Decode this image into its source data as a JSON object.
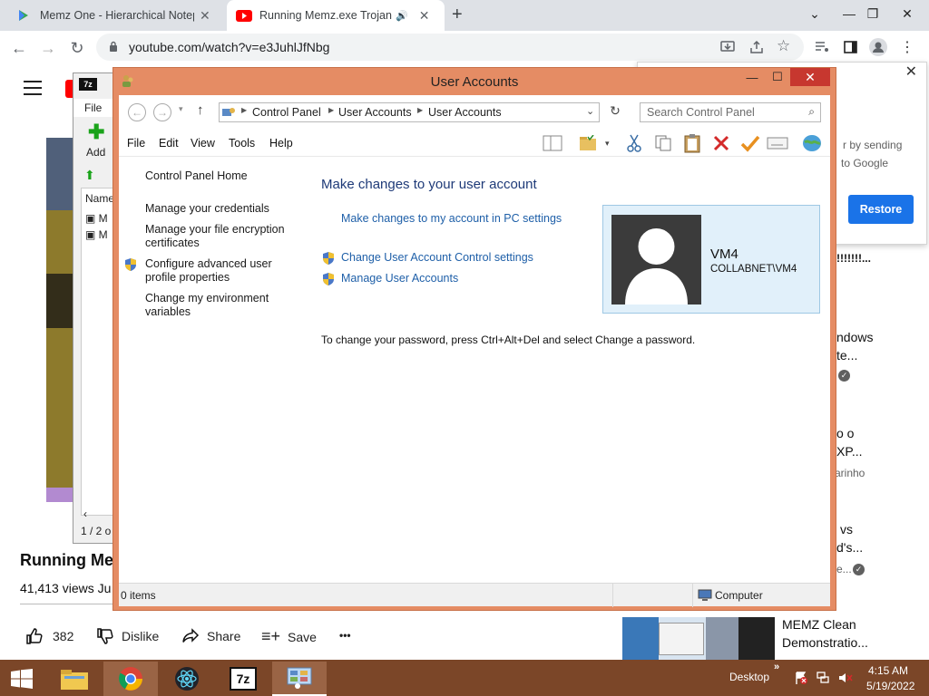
{
  "browser": {
    "tabs": [
      {
        "title": "Memz One - Hierarchical Notepad"
      },
      {
        "title": "Running Memz.exe Trojan on"
      }
    ],
    "url": "youtube.com/watch?v=e3JuhlJfNbg"
  },
  "youtube": {
    "video_title": "Running Mem",
    "views": "41,413 views  Ju",
    "likes": "382",
    "dislike_label": "Dislike",
    "share_label": "Share",
    "save_label": "Save",
    "more_label": "•••",
    "restore_label": "Restore",
    "dialog_text": [
      "r by sending",
      "to Google"
    ],
    "sidebar_fragments": [
      "!!!!!!!...",
      "ndows",
      "te...",
      "o o",
      "XP...",
      "arinho",
      "vs",
      "d's...",
      "e...",
      "MEMZ Clean",
      "Demonstratio..."
    ]
  },
  "sevenzip": {
    "menu_file": "File",
    "add_label": "Add",
    "name_col": "Name",
    "rows": [
      "M",
      "M"
    ],
    "status": "1 / 2 o"
  },
  "window": {
    "title": "User Accounts",
    "breadcrumb": [
      "Control Panel",
      "User Accounts",
      "User Accounts"
    ],
    "search_placeholder": "Search Control Panel",
    "menu": [
      "File",
      "Edit",
      "View",
      "Tools",
      "Help"
    ],
    "sidebar": {
      "home": "Control Panel Home",
      "credentials": "Manage your credentials",
      "encryption_1": "Manage your file encryption",
      "encryption_2": "certificates",
      "advanced_1": "Configure advanced user",
      "advanced_2": "profile properties",
      "environment_1": "Change my environment",
      "environment_2": "variables"
    },
    "main": {
      "heading": "Make changes to your user account",
      "pc_settings": "Make changes to my account in PC settings",
      "uac": "Change User Account Control settings",
      "manage": "Manage User Accounts",
      "password_note": "To change your password, press Ctrl+Alt+Del and select Change a password."
    },
    "user": {
      "name": "VM4",
      "domain": "COLLABNET\\VM4"
    },
    "status": {
      "items": "0 items",
      "location": "Computer"
    }
  },
  "taskbar": {
    "desktop_label": "Desktop",
    "time": "4:15 AM",
    "date": "5/19/2022",
    "sevenzip_label": "7z"
  },
  "colors": {
    "window_frame": "#e58c64",
    "close_red": "#c7372f",
    "link_blue": "#1e5fa8",
    "taskbar": "#7b4628",
    "restore_blue": "#1a73e8"
  }
}
